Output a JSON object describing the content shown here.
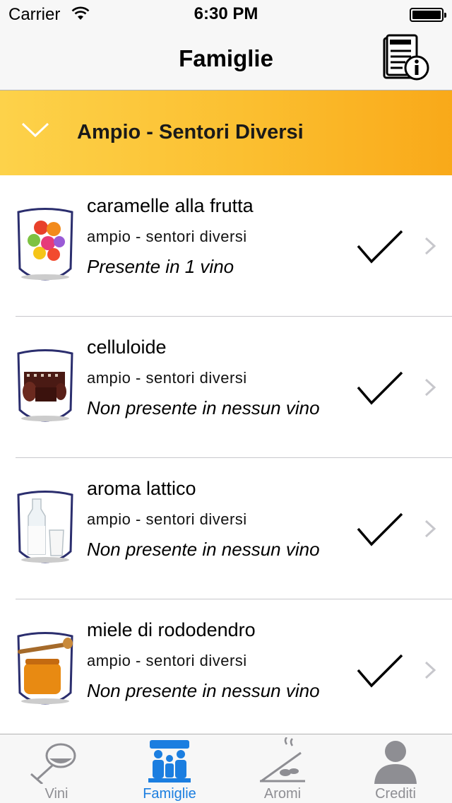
{
  "status_bar": {
    "carrier": "Carrier",
    "time": "6:30 PM"
  },
  "nav": {
    "title": "Famiglie",
    "info_icon": "book-info-icon"
  },
  "section": {
    "title": "Ampio - Sentori Diversi",
    "icon": "chevron-down-icon"
  },
  "rows": [
    {
      "title": "caramelle alla frutta",
      "subtitle": "ampio - sentori diversi",
      "status": "Presente in 1 vino",
      "thumb": "fruit-candy-icon",
      "checked": true
    },
    {
      "title": "celluloide",
      "subtitle": "ampio - sentori diversi",
      "status": "Non presente in nessun vino",
      "thumb": "film-roll-icon",
      "checked": true
    },
    {
      "title": "aroma lattico",
      "subtitle": "ampio - sentori diversi",
      "status": "Non presente in nessun vino",
      "thumb": "milk-bottle-icon",
      "checked": true
    },
    {
      "title": "miele di rododendro",
      "subtitle": "ampio - sentori diversi",
      "status": "Non presente in nessun vino",
      "thumb": "honey-jar-icon",
      "checked": true
    }
  ],
  "tabs": [
    {
      "label": "Vini",
      "icon": "wine-glass-icon",
      "active": false
    },
    {
      "label": "Famiglie",
      "icon": "family-icon",
      "active": true
    },
    {
      "label": "Aromi",
      "icon": "aroma-icon",
      "active": false
    },
    {
      "label": "Crediti",
      "icon": "person-icon",
      "active": false
    }
  ],
  "colors": {
    "accent": "#1b7ee0",
    "header_start": "#fdd24a",
    "header_end": "#f9a919",
    "inactive": "#8e8e93"
  }
}
